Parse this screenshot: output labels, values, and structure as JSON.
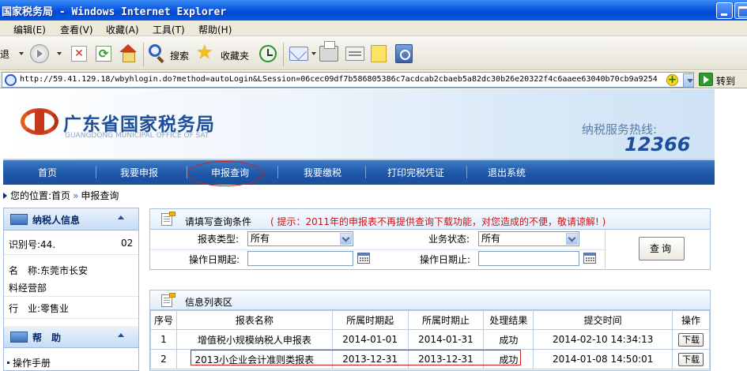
{
  "window": {
    "title": "国家税务局 - Windows Internet Explorer"
  },
  "menubar": {
    "items": [
      "编辑(E)",
      "查看(V)",
      "收藏(A)",
      "工具(T)",
      "帮助(H)"
    ]
  },
  "toolbar": {
    "back_label": "退",
    "search_label": "搜索",
    "favorites_label": "收藏夹",
    "icons": [
      "forward-icon",
      "stop-icon",
      "refresh-icon",
      "home-icon",
      "search-icon",
      "favorites-star-icon",
      "history-icon",
      "mail-icon",
      "print-icon",
      "edit-icon",
      "note-icon",
      "research-icon"
    ]
  },
  "addressbar": {
    "url": "http://59.41.129.18/wbyhlogin.do?method=autoLogin&LSession=06cec09df7b5868053​86c7acdcab2cbaeb5a82dc30b26e20322f4c6aaee63040b70cb9a9254",
    "go_label": "转到"
  },
  "site": {
    "title": "广东省国家税务局",
    "subtitle": "GUANGDONG MUNICIPAL OFFICE OF SAT",
    "hotline_label": "纳税服务热线:",
    "hotline_number": "12366",
    "brand_color": "#1e4d9a",
    "logo_color": "#d0421b"
  },
  "nav": {
    "items": [
      "首页",
      "我要申报",
      "申报查询",
      "我要缴税",
      "打印完税凭证",
      "退出系统"
    ],
    "active": "申报查询"
  },
  "breadcrumb": {
    "prefix": "您的位置:",
    "home": "首页",
    "sep": "»",
    "current": "申报查询"
  },
  "sidebar": {
    "taxpayer": {
      "title": "纳税人信息",
      "id_label": "识别号:",
      "id_value": "44.",
      "id_tail": "02",
      "name_label": "名　称:",
      "name_value": "东莞市长安",
      "name_line2": "料经营部",
      "industry_label": "行　业:",
      "industry_value": "零售业"
    },
    "help": {
      "title": "帮　助",
      "links": [
        "操作手册"
      ]
    }
  },
  "query": {
    "title": "请填写查询条件",
    "tip": "( 提示：2011年的申报表不再提供查询下载功能，对您造成的不便，敬请谅解! )",
    "report_type_label": "报表类型:",
    "report_type_value": "所有",
    "status_label": "业务状态:",
    "status_value": "所有",
    "date_from_label": "操作日期起:",
    "date_from_value": "",
    "date_to_label": "操作日期止:",
    "date_to_value": "",
    "search_button": "查询"
  },
  "list": {
    "title": "信息列表区",
    "columns": [
      "序号",
      "报表名称",
      "所属时期起",
      "所属时期止",
      "处理结果",
      "提交时间",
      "操作"
    ],
    "rows": [
      {
        "no": "1",
        "name": "增值税小规模纳税人申报表",
        "from": "2014-01-01",
        "to": "2014-01-31",
        "result": "成功",
        "submitted": "2014-02-10 14:34:13",
        "action": "下载"
      },
      {
        "no": "2",
        "name": "2013小企业会计准则类报表",
        "from": "2013-12-31",
        "to": "2013-12-31",
        "result": "成功",
        "submitted": "2014-01-08 14:50:01",
        "action": "下载"
      }
    ]
  }
}
